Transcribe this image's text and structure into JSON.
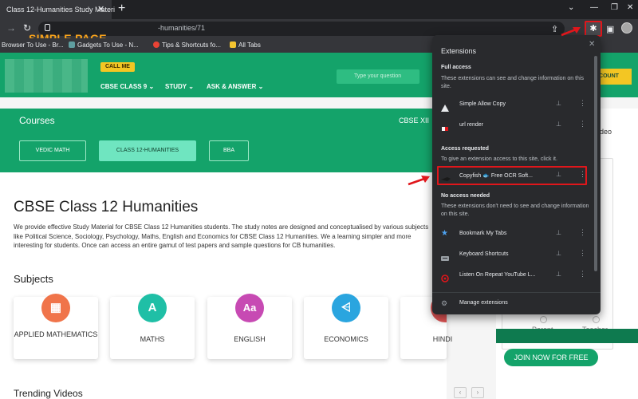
{
  "browser": {
    "tab_title": "Class 12-Humanities Study Materi",
    "tab_close": "✕",
    "new_tab": "+",
    "url": "-humanities/71",
    "window_min": "⌄",
    "window_min2": "—",
    "window_max": "❐",
    "window_close": "✕"
  },
  "watermark": {
    "brand": "SIMPLE PAGE"
  },
  "bookmarks": [
    {
      "label": "Browser To Use - Br...",
      "color": "#9aa0a6"
    },
    {
      "label": "Gadgets To Use - N...",
      "color": "#5f9ea0"
    },
    {
      "label": "Tips & Shortcuts fo...",
      "color": "#ea4335"
    },
    {
      "label": "All Tabs",
      "color": "#f4c430"
    }
  ],
  "site": {
    "call_me": "CALL ME",
    "nav": [
      {
        "label": "CBSE CLASS 9 ⌄"
      },
      {
        "label": "STUDY ⌄"
      },
      {
        "label": "ASK & ANSWER ⌄"
      }
    ],
    "search_placeholder": "Type your question",
    "account_button": "CCOUNT",
    "courses_title": "Courses",
    "cbse_right": "CBSE XII",
    "course_pills": [
      "VEDIC MATH",
      "CLASS 12-HUMANITIES",
      "BBA"
    ],
    "heading": "CBSE Class 12 Humanities",
    "description": "We provide effective Study Material for CBSE Class 12 Humanities students. The study notes are designed and conceptualised by various subjects like Political Science, Sociology, Psychology, Maths, English and Economics for CBSE Class 12 Humanities. We a learning simpler and more interesting for students. Once can access an entire gamut of test papers and sample questions for CB humanities.",
    "subjects_title": "Subjects",
    "subjects": [
      {
        "label": "APPLIED MATHEMATICS",
        "icon": "calculator-icon",
        "color": "#f0744a",
        "glyph": "▦"
      },
      {
        "label": "MATHS",
        "icon": "compass-icon",
        "color": "#1fbfa6",
        "glyph": "A"
      },
      {
        "label": "ENGLISH",
        "icon": "aa-icon",
        "color": "#c74ab3",
        "glyph": "Aa"
      },
      {
        "label": "ECONOMICS",
        "icon": "chart-icon",
        "color": "#2aa5df",
        "glyph": "⩤"
      },
      {
        "label": "HINDI",
        "icon": "hindi-icon",
        "color": "#e25555",
        "glyph": "अ"
      }
    ],
    "trending_title": "Trending Videos",
    "arrow_left": "‹",
    "arrow_right": "›",
    "right_video": "deo",
    "parent_label": "Parent",
    "teacher_label": "Teacher",
    "join_button": "JOIN NOW FOR FREE"
  },
  "extensions": {
    "title": "Extensions",
    "close": "✕",
    "full_access_title": "Full access",
    "full_access_desc": "These extensions can see and change information on this site.",
    "full_access": [
      {
        "name": "Simple Allow Copy",
        "icon": "allow-copy-icon"
      },
      {
        "name": "url render",
        "icon": "url-render-icon"
      }
    ],
    "requested_title": "Access requested",
    "requested_desc": "To give an extension access to this site, click it.",
    "requested": [
      {
        "name": "Copyfish 🐟 Free OCR Soft...",
        "icon": "copyfish-icon"
      }
    ],
    "no_access_title": "No access needed",
    "no_access_desc": "These extensions don't need to see and change information on this site.",
    "no_access": [
      {
        "name": "Bookmark My Tabs",
        "icon": "star-icon"
      },
      {
        "name": "Keyboard Shortcuts",
        "icon": "keyboard-icon"
      },
      {
        "name": "Listen On Repeat YouTube L...",
        "icon": "repeat-icon"
      }
    ],
    "pin": "⊥",
    "more": "⋮",
    "manage": "Manage extensions"
  }
}
